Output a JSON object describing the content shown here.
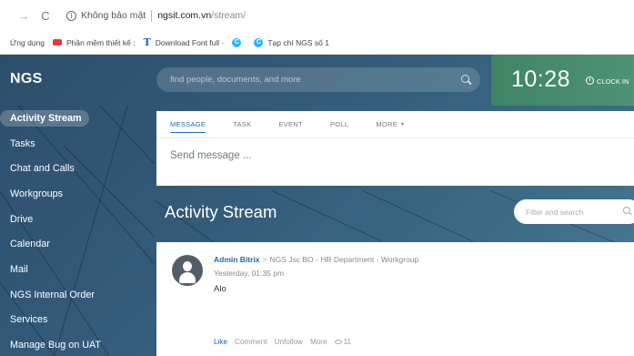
{
  "browser": {
    "security_text": "Không bảo mật",
    "url_host": "ngsit.com.vn",
    "url_path": "/stream/",
    "bookmarks": [
      {
        "label": "Ứng dụng",
        "icon": "apps-icon"
      },
      {
        "label": "Phần mềm thiết kế :",
        "icon": "youtube-icon"
      },
      {
        "label": "Download Font full ·",
        "icon": "t-icon"
      },
      {
        "label": "",
        "icon": "c-icon"
      },
      {
        "label": "Tạp chí NGS số 1",
        "icon": "c-icon"
      }
    ]
  },
  "header": {
    "logo": "NGS",
    "search_placeholder": "find people, documents, and more",
    "clock_time": "10:28",
    "clock_in_label": "CLOCK IN",
    "clock_color": "#4a8f6f"
  },
  "sidebar": {
    "items": [
      {
        "label": "Activity Stream",
        "active": true
      },
      {
        "label": "Tasks"
      },
      {
        "label": "Chat and Calls"
      },
      {
        "label": "Workgroups"
      },
      {
        "label": "Drive"
      },
      {
        "label": "Calendar"
      },
      {
        "label": "Mail"
      },
      {
        "label": "NGS Internal Order"
      },
      {
        "label": "Services"
      },
      {
        "label": "Manage Bug on UAT"
      }
    ]
  },
  "composer": {
    "tabs": [
      "MESSAGE",
      "TASK",
      "EVENT",
      "POLL",
      "MORE"
    ],
    "active_tab": "MESSAGE",
    "placeholder": "Send message ..."
  },
  "stream": {
    "title": "Activity Stream",
    "filter_placeholder": "Filter and search"
  },
  "post": {
    "author": "Admin Bitrix",
    "destination": "NGS Jsc BO - HR Department - Workgroup",
    "time": "Yesterday, 01:35 pm",
    "text": "Alo",
    "actions": {
      "like": "Like",
      "comment": "Comment",
      "unfollow": "Unfollow",
      "more": "More",
      "views": "11"
    }
  },
  "colors": {
    "accent": "#2067b0",
    "sidebar_bg": "#2c4e6b"
  }
}
